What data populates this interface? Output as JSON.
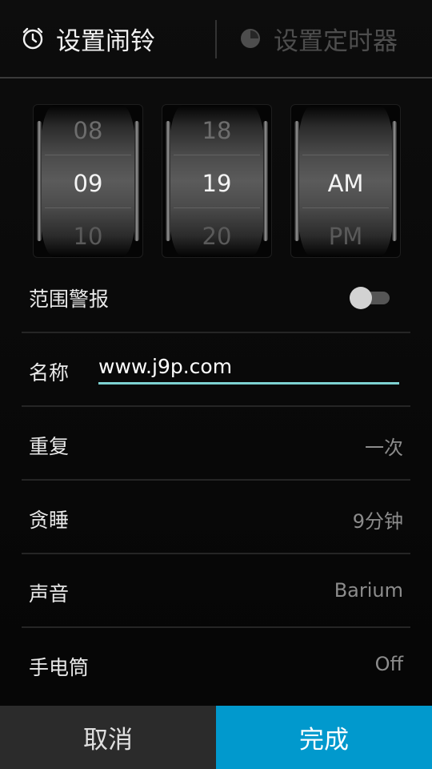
{
  "tabs": [
    {
      "label": "设置闹铃",
      "icon": "alarm-clock-icon",
      "active": true
    },
    {
      "label": "设置定时器",
      "icon": "timer-icon",
      "active": false
    }
  ],
  "pickers": {
    "hour": {
      "prev": "08",
      "current": "09",
      "next": "10"
    },
    "minute": {
      "prev": "18",
      "current": "19",
      "next": "20"
    },
    "ampm": {
      "prev": "",
      "current": "AM",
      "next": "PM"
    }
  },
  "settings": {
    "range_alert": {
      "label": "范围警报",
      "enabled": false
    },
    "name": {
      "label": "名称",
      "value": "www.j9p.com"
    },
    "repeat": {
      "label": "重复",
      "value": "一次"
    },
    "snooze": {
      "label": "贪睡",
      "value": "9分钟"
    },
    "sound": {
      "label": "声音",
      "value": "Barium"
    },
    "flashlight": {
      "label": "手电筒",
      "value": "Off"
    }
  },
  "buttons": {
    "cancel": "取消",
    "done": "完成"
  },
  "colors": {
    "accent": "#0199cd",
    "input_underline": "#7ed2d2"
  }
}
